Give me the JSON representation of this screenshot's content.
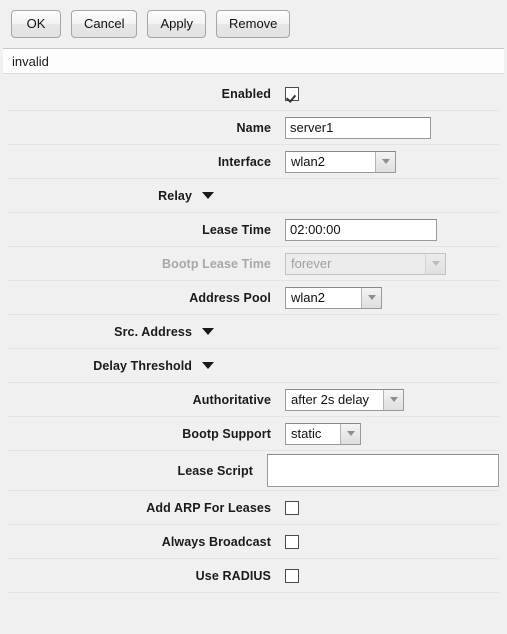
{
  "toolbar": {
    "buttons": [
      {
        "label": "OK",
        "name": "ok-button"
      },
      {
        "label": "Cancel",
        "name": "cancel-button"
      },
      {
        "label": "Apply",
        "name": "apply-button"
      },
      {
        "label": "Remove",
        "name": "remove-button"
      }
    ]
  },
  "status": {
    "text": "invalid"
  },
  "form": {
    "enabled": {
      "label": "Enabled",
      "checked": true
    },
    "name": {
      "label": "Name",
      "value": "server1"
    },
    "interface": {
      "label": "Interface",
      "value": "wlan2"
    },
    "relay": {
      "label": "Relay"
    },
    "lease_time": {
      "label": "Lease Time",
      "value": "02:00:00"
    },
    "bootp_lease": {
      "label": "Bootp Lease Time",
      "value": "forever"
    },
    "address_pool": {
      "label": "Address Pool",
      "value": "wlan2"
    },
    "src_address": {
      "label": "Src. Address"
    },
    "delay_threshold": {
      "label": "Delay Threshold"
    },
    "authoritative": {
      "label": "Authoritative",
      "value": "after 2s delay"
    },
    "bootp_support": {
      "label": "Bootp Support",
      "value": "static"
    },
    "lease_script": {
      "label": "Lease Script",
      "value": ""
    },
    "add_arp": {
      "label": "Add ARP For Leases",
      "checked": false
    },
    "always_bcast": {
      "label": "Always Broadcast",
      "checked": false
    },
    "use_radius": {
      "label": "Use RADIUS",
      "checked": false
    }
  }
}
